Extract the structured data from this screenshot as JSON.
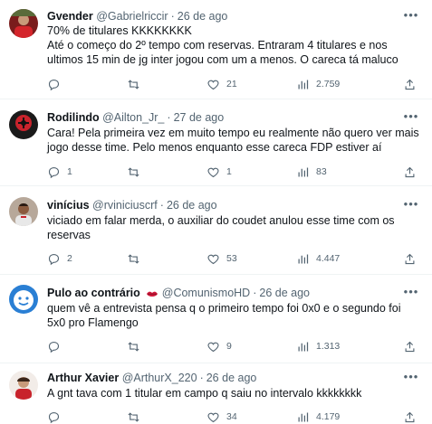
{
  "tweets": [
    {
      "name": "Gvender",
      "handle": "@Gabrielriccir",
      "date": "26 de ago",
      "text": "70% de titulares KKKKKKKK\nAté o começo do 2º tempo com reservas. Entraram 4 titulares e nos ultimos 15 min de jg inter jogou com um a menos. O careca tá maluco",
      "replies": "",
      "retweets": "",
      "likes": "21",
      "views": "2.759"
    },
    {
      "name": "Rodilindo",
      "handle": "@Ailton_Jr_",
      "date": "27 de ago",
      "text": "Cara! Pela primeira vez em muito tempo eu realmente não quero ver mais jogo desse time. Pelo menos enquanto esse careca FDP estiver aí",
      "replies": "1",
      "retweets": "",
      "likes": "1",
      "views": "83"
    },
    {
      "name": "vinícius",
      "handle": "@rviniciuscrf",
      "date": "26 de ago",
      "text": "viciado em falar merda, o auxiliar do coudet anulou esse time com os reservas",
      "replies": "2",
      "retweets": "",
      "likes": "53",
      "views": "4.447"
    },
    {
      "name": "Pulo ao contrário",
      "handle": "@ComunismoHD",
      "date": "26 de ago",
      "text": "quem vê a entrevista pensa q o primeiro tempo foi 0x0 e o segundo foi 5x0 pro Flamengo",
      "replies": "",
      "retweets": "",
      "likes": "9",
      "views": "1.313"
    },
    {
      "name": "Arthur Xavier",
      "handle": "@ArthurX_220",
      "date": "26 de ago",
      "text": "A gnt tava com 1 titular em campo q saiu no intervalo kkkkkkkk",
      "replies": "",
      "retweets": "",
      "likes": "34",
      "views": "4.179"
    }
  ],
  "icons": {
    "reply": "reply-icon",
    "retweet": "retweet-icon",
    "like": "heart-icon",
    "views": "views-icon",
    "share": "share-icon",
    "more": "more-icon"
  },
  "colors": {
    "text": "#0f1419",
    "secondary": "#536471",
    "divider": "#eff3f4"
  }
}
